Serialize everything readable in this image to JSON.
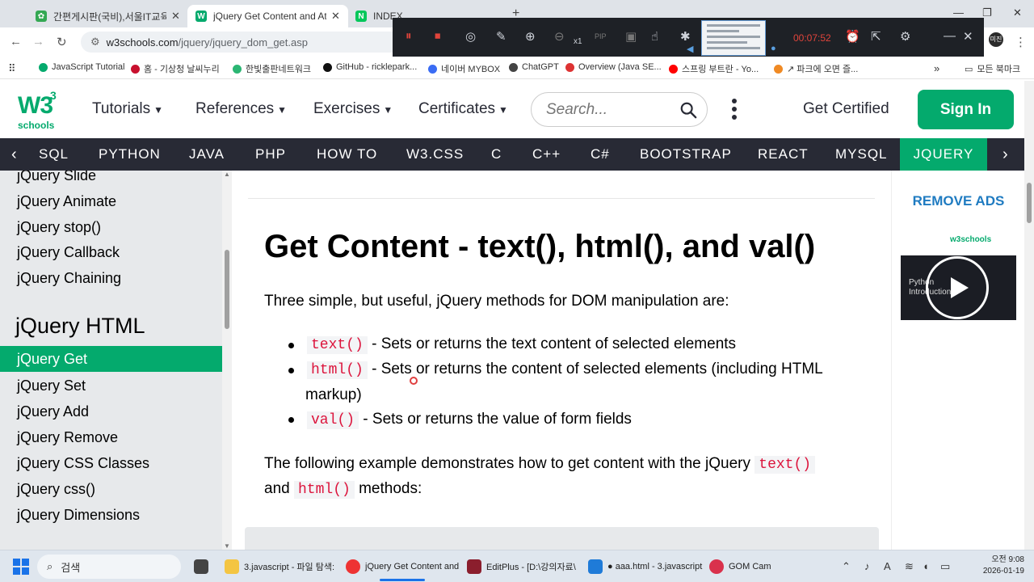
{
  "browser": {
    "tabs": [
      {
        "title": "간편게시판(국비),서울IT교육센",
        "active": false
      },
      {
        "title": "jQuery Get Content and Attrib",
        "active": true
      },
      {
        "title": "INDEX",
        "active": false
      }
    ],
    "url_domain": "w3schools.com",
    "url_path": "/jquery/jquery_dom_get.asp"
  },
  "recorder": {
    "time": "00:07:52",
    "speed": "x1",
    "pip": "PIP"
  },
  "bookmarks": {
    "items": [
      "JavaScript Tutorial",
      "홈 - 기상청 날씨누리",
      "한빛출판네트워크",
      "GitHub - ricklepark...",
      "네이버 MYBOX",
      "ChatGPT",
      "Overview (Java SE...",
      "스프링 부트란 - Yo...",
      "↗ 파크에 오면 즐..."
    ],
    "more": "»",
    "all_bookmarks": "모든 북마크"
  },
  "nav": {
    "logo_main": "W3",
    "logo_sup": "3",
    "logo_sub": "schools",
    "menu": [
      "Tutorials",
      "References",
      "Exercises",
      "Certificates"
    ],
    "search_placeholder": "Search...",
    "get_certified": "Get Certified",
    "sign_in": "Sign In"
  },
  "langbar": {
    "items": [
      "SQL",
      "PYTHON",
      "JAVA",
      "PHP",
      "HOW TO",
      "W3.CSS",
      "C",
      "C++",
      "C#",
      "BOOTSTRAP",
      "REACT",
      "MYSQL",
      "JQUERY"
    ],
    "active": "JQUERY"
  },
  "sidebar": {
    "items_top": [
      "jQuery Slide",
      "jQuery Animate",
      "jQuery stop()",
      "jQuery Callback",
      "jQuery Chaining"
    ],
    "section": "jQuery HTML",
    "active": "jQuery Get",
    "items_bottom": [
      "jQuery Set",
      "jQuery Add",
      "jQuery Remove",
      "jQuery CSS Classes",
      "jQuery css()",
      "jQuery Dimensions"
    ]
  },
  "content": {
    "title": "Get Content - text(), html(), and val()",
    "intro": "Three simple, but useful, jQuery methods for DOM manipulation are:",
    "bullets": [
      {
        "code": "text()",
        "text": " - Sets or returns the text content of selected elements"
      },
      {
        "code": "html()",
        "text": " - Sets or returns the content of selected elements (including HTML",
        "text2": "markup)"
      },
      {
        "code": "val()",
        "text": " - Sets or returns the value of form fields"
      }
    ],
    "example_a": "The following example demonstrates how to get content with the jQuery ",
    "example_code1": "text()",
    "example_b": "and ",
    "example_code2": "html()",
    "example_c": " methods:"
  },
  "ad": {
    "remove_ads": "REMOVE ADS",
    "logo": "w3schools",
    "video_text_1": "Python",
    "video_text_2": "Introduction"
  },
  "taskbar": {
    "search": "검색",
    "apps": [
      "3.javascript - 파일 탐색:",
      "jQuery Get Content and",
      "EditPlus - [D:\\강의자료\\",
      "● aaa.html - 3.javascript",
      "GOM Cam"
    ],
    "time": "오전 9:08",
    "date": "2026-01-19"
  }
}
